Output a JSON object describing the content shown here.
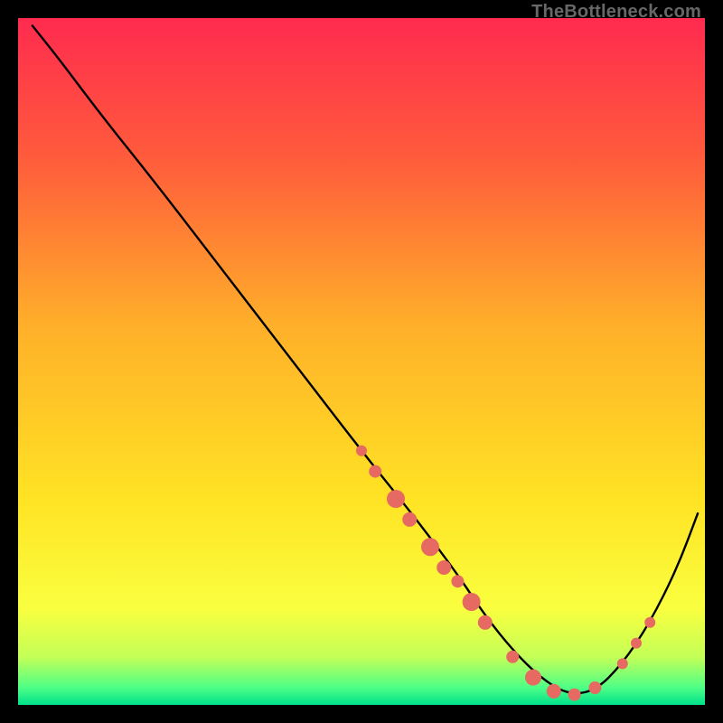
{
  "watermark": "TheBottleneck.com",
  "chart_data": {
    "type": "line",
    "title": "",
    "xlabel": "",
    "ylabel": "",
    "xlim": [
      0,
      100
    ],
    "ylim": [
      0,
      100
    ],
    "gradient_stops": [
      {
        "offset": 0.0,
        "color": "#ff2b4f"
      },
      {
        "offset": 0.2,
        "color": "#ff5a3c"
      },
      {
        "offset": 0.45,
        "color": "#ffb029"
      },
      {
        "offset": 0.7,
        "color": "#ffe324"
      },
      {
        "offset": 0.86,
        "color": "#f9ff3f"
      },
      {
        "offset": 0.93,
        "color": "#c4ff57"
      },
      {
        "offset": 0.975,
        "color": "#4dff86"
      },
      {
        "offset": 1.0,
        "color": "#00e08a"
      }
    ],
    "series": [
      {
        "name": "bottleneck-curve",
        "x": [
          2,
          6,
          12,
          20,
          30,
          40,
          50,
          58,
          64,
          68,
          72,
          76,
          80,
          84,
          88,
          92,
          96,
          99
        ],
        "y": [
          99,
          94,
          86,
          76,
          63,
          50,
          37,
          27,
          19,
          13,
          8,
          4,
          1.5,
          2,
          6,
          12,
          20,
          28
        ]
      }
    ],
    "markers": {
      "name": "highlight-dots",
      "color": "#e66a61",
      "points": [
        {
          "x": 50,
          "y": 37,
          "r": 6
        },
        {
          "x": 52,
          "y": 34,
          "r": 7
        },
        {
          "x": 55,
          "y": 30,
          "r": 10
        },
        {
          "x": 57,
          "y": 27,
          "r": 8
        },
        {
          "x": 60,
          "y": 23,
          "r": 10
        },
        {
          "x": 62,
          "y": 20,
          "r": 8
        },
        {
          "x": 64,
          "y": 18,
          "r": 7
        },
        {
          "x": 66,
          "y": 15,
          "r": 10
        },
        {
          "x": 68,
          "y": 12,
          "r": 8
        },
        {
          "x": 72,
          "y": 7,
          "r": 7
        },
        {
          "x": 75,
          "y": 4,
          "r": 9
        },
        {
          "x": 78,
          "y": 2,
          "r": 8
        },
        {
          "x": 81,
          "y": 1.5,
          "r": 7
        },
        {
          "x": 84,
          "y": 2.5,
          "r": 7
        },
        {
          "x": 88,
          "y": 6,
          "r": 6
        },
        {
          "x": 90,
          "y": 9,
          "r": 6
        },
        {
          "x": 92,
          "y": 12,
          "r": 6
        }
      ]
    }
  }
}
